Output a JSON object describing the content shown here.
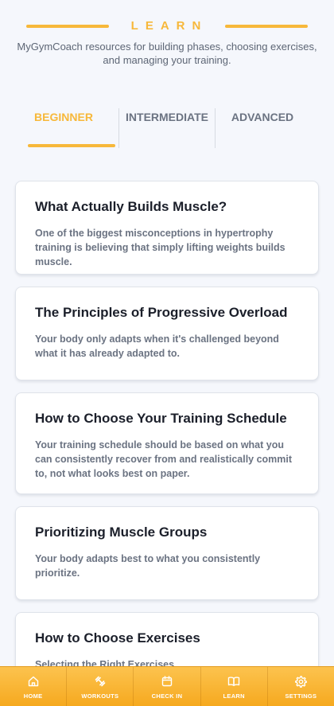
{
  "header": {
    "title": "LEARN",
    "subtitle": "MyGymCoach resources for building phases, choosing exercises, and managing your training."
  },
  "tabs": [
    {
      "label": "BEGINNER",
      "active": true
    },
    {
      "label": "INTERMEDIATE",
      "active": false
    },
    {
      "label": "ADVANCED",
      "active": false
    }
  ],
  "articles": [
    {
      "title": "What Actually Builds Muscle?",
      "description": "One of the biggest misconceptions in hypertrophy training is believing that simply lifting weights builds muscle."
    },
    {
      "title": "The Principles of Progressive Overload",
      "description": "Your body only adapts when it's challenged beyond what it has already adapted to."
    },
    {
      "title": "How to Choose Your Training Schedule",
      "description": "Your training schedule should be based on what you can consistently recover from and realistically commit to, not what looks best on paper."
    },
    {
      "title": "Prioritizing Muscle Groups",
      "description": "Your body adapts best to what you consistently prioritize."
    },
    {
      "title": "How to Choose Exercises",
      "description": "Selecting the Right Exercises"
    }
  ],
  "nav": [
    {
      "label": "HOME",
      "icon": "home-icon"
    },
    {
      "label": "WORKOUTS",
      "icon": "dumbbell-icon"
    },
    {
      "label": "CHECK IN",
      "icon": "calendar-icon"
    },
    {
      "label": "LEARN",
      "icon": "book-icon"
    },
    {
      "label": "SETTINGS",
      "icon": "gear-icon"
    }
  ],
  "colors": {
    "accent": "#f7b83a",
    "background": "#f5f7fc",
    "nav_gradient_top": "#fcc34e",
    "nav_gradient_bottom": "#f6a91f"
  }
}
